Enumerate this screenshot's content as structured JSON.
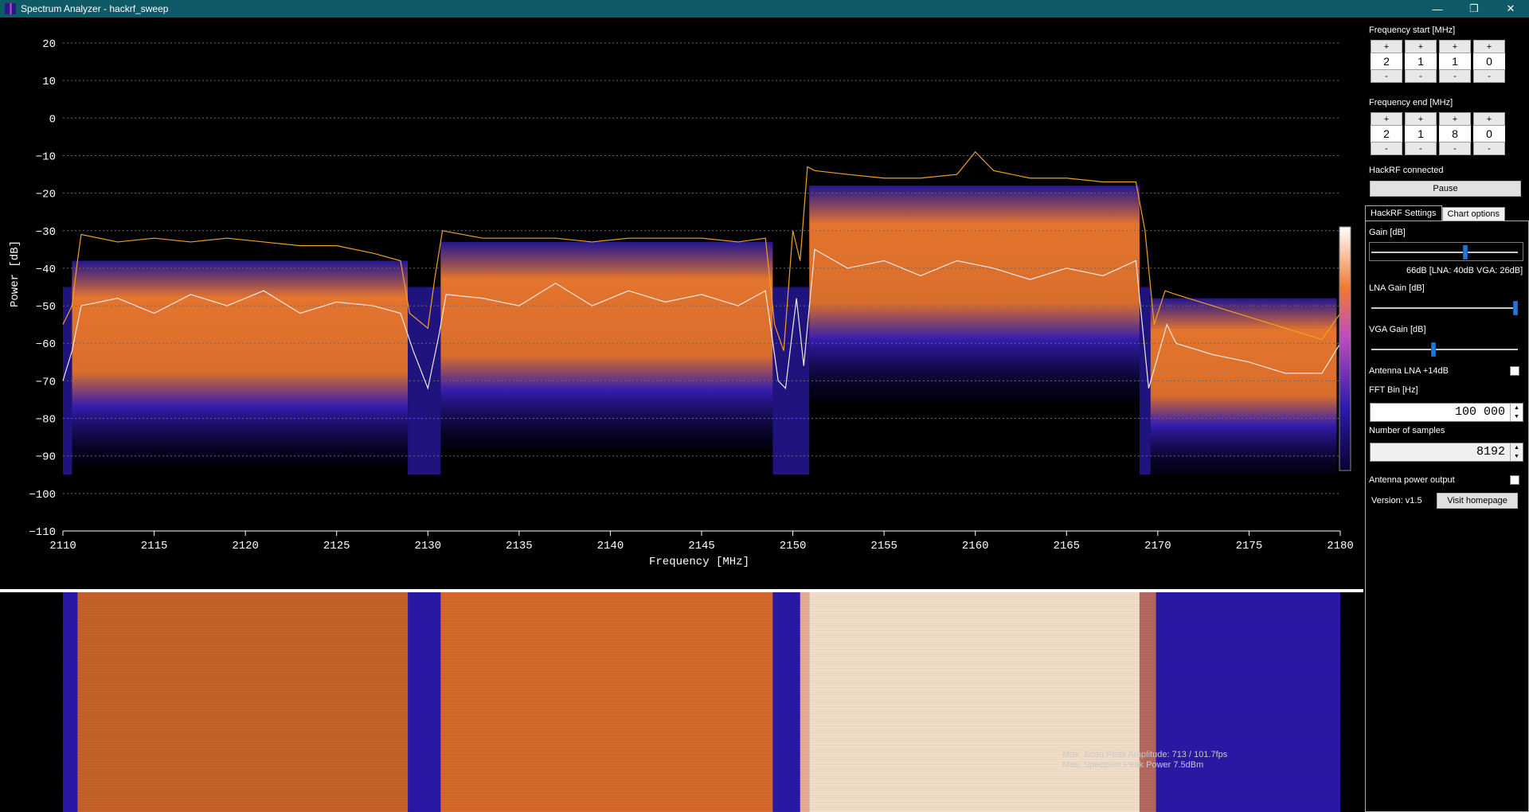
{
  "window": {
    "title": "Spectrum Analyzer - hackrf_sweep",
    "minimize": "—",
    "restore": "❐",
    "close": "✕"
  },
  "colors": {
    "titlebar": "#0f5a66",
    "peak_trace": "#f0a020",
    "current_trace": "#f0e8e8",
    "spectrum_low": "#2a1aa8",
    "spectrum_high": "#f07a30",
    "accent": "#1e78d7"
  },
  "chart_data": {
    "type": "line",
    "xlabel": "Frequency [MHz]",
    "ylabel": "Power [dB]",
    "xlim": [
      2110,
      2180
    ],
    "ylim": [
      -110,
      25
    ],
    "x_ticks": [
      "2110",
      "2115",
      "2120",
      "2125",
      "2130",
      "2135",
      "2140",
      "2145",
      "2150",
      "2155",
      "2160",
      "2165",
      "2170",
      "2175",
      "2180"
    ],
    "y_ticks": [
      "20",
      "10",
      "0",
      "−10",
      "−20",
      "−30",
      "−40",
      "−50",
      "−60",
      "−70",
      "−80",
      "−90",
      "−100",
      "−110"
    ],
    "grid": true,
    "series": [
      {
        "name": "",
        "role": "peak-hold",
        "x": [
          2110,
          2110.5,
          2110.8,
          2111,
          2113,
          2115,
          2117,
          2119,
          2121,
          2123,
          2125,
          2127,
          2128.5,
          2129,
          2130,
          2130.4,
          2130.8,
          2133,
          2135,
          2137,
          2139,
          2141,
          2143,
          2145,
          2147,
          2148.5,
          2149,
          2149.5,
          2150,
          2150.4,
          2150.8,
          2151.2,
          2153,
          2155,
          2157,
          2159,
          2160,
          2161,
          2163,
          2165,
          2167,
          2168.8,
          2169.3,
          2169.8,
          2170.4,
          2171,
          2173,
          2175,
          2177,
          2179,
          2180
        ],
        "values": [
          -55,
          -50,
          -38,
          -31,
          -33,
          -32,
          -33,
          -32,
          -33,
          -34,
          -34,
          -36,
          -38,
          -52,
          -56,
          -42,
          -30,
          -32,
          -32,
          -32,
          -33,
          -32,
          -32,
          -32,
          -33,
          -32,
          -55,
          -62,
          -30,
          -38,
          -13,
          -14,
          -15,
          -16,
          -16,
          -15,
          -9,
          -14,
          -16,
          -16,
          -17,
          -17,
          -30,
          -55,
          -46,
          -47,
          -50,
          -53,
          -56,
          -59,
          -52
        ]
      },
      {
        "name": "",
        "role": "current",
        "x": [
          2110,
          2110.5,
          2111,
          2113,
          2115,
          2117,
          2119,
          2121,
          2123,
          2125,
          2127,
          2128.5,
          2129.2,
          2130,
          2130.6,
          2131,
          2133,
          2135,
          2137,
          2139,
          2141,
          2143,
          2145,
          2147,
          2148.5,
          2149.2,
          2149.6,
          2150.2,
          2150.6,
          2151.2,
          2153,
          2155,
          2157,
          2159,
          2161,
          2163,
          2165,
          2167,
          2168.8,
          2169.5,
          2170.5,
          2171,
          2173,
          2175,
          2177,
          2179,
          2180
        ],
        "values": [
          -70,
          -62,
          -50,
          -48,
          -52,
          -47,
          -50,
          -46,
          -52,
          -49,
          -50,
          -52,
          -62,
          -72,
          -58,
          -47,
          -48,
          -50,
          -44,
          -50,
          -46,
          -49,
          -47,
          -50,
          -46,
          -70,
          -72,
          -48,
          -66,
          -35,
          -40,
          -38,
          -42,
          -38,
          -40,
          -43,
          -40,
          -42,
          -38,
          -72,
          -55,
          -60,
          -63,
          -65,
          -68,
          -68,
          -60
        ]
      }
    ]
  },
  "waterfall": {
    "status_line1": "Max. Scan Peak Amplitude: 713 / 101.7fps",
    "status_line2": "Max. Spectrum Peak Power 7.5dBm"
  },
  "panel": {
    "freq_start": {
      "label": "Frequency start [MHz]",
      "plus": "+",
      "minus": "-",
      "digits": [
        "2",
        "1",
        "1",
        "0"
      ]
    },
    "freq_end": {
      "label": "Frequency end [MHz]",
      "plus": "+",
      "minus": "-",
      "digits": [
        "2",
        "1",
        "8",
        "0"
      ]
    },
    "status": "HackRF connected",
    "pause_label": "Pause",
    "tabs": [
      "HackRF Settings",
      "Chart options"
    ],
    "gain_label": "Gain [dB]",
    "gain_value": 66,
    "gain_readout": "66dB  [LNA: 40dB   VGA: 26dB]",
    "lna_label": "LNA Gain [dB]",
    "lna_value": 40,
    "vga_label": "VGA Gain [dB]",
    "vga_value": 26,
    "antenna_lna_label": "Antenna LNA +14dB",
    "fft_label": "FFT Bin [Hz]",
    "fft_value": "100 000",
    "samples_label": "Number of samples",
    "samples_value": "8192",
    "antenna_power_label": "Antenna power output",
    "version": "Version: v1.5",
    "homepage_label": "Visit homepage"
  }
}
